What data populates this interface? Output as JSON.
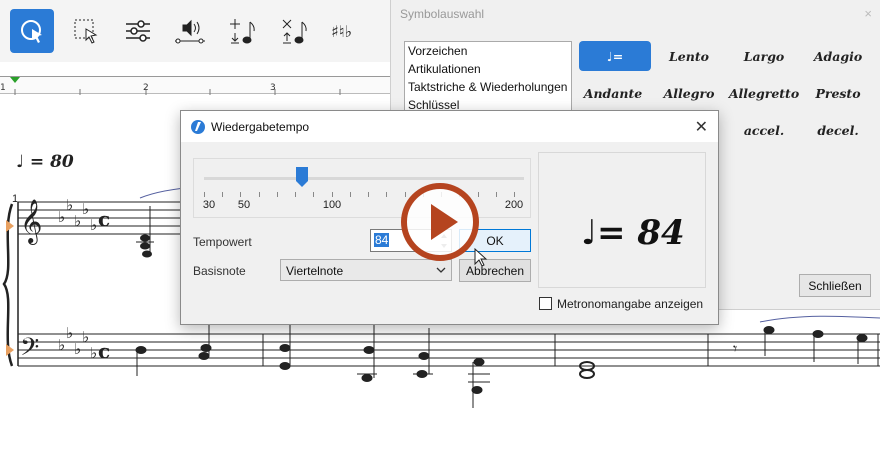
{
  "toolbar": {
    "tools": [
      {
        "icon": "pointer-select-icon",
        "active": true
      },
      {
        "icon": "marquee-select-icon"
      },
      {
        "icon": "mixer-sliders-icon"
      },
      {
        "icon": "playback-speaker-icon"
      },
      {
        "icon": "add-note-icon"
      },
      {
        "icon": "delete-note-icon"
      },
      {
        "icon": "accidentals-icon"
      }
    ]
  },
  "ruler": {
    "labels": [
      "1",
      "2",
      "3"
    ]
  },
  "score": {
    "tempo_mark": "♩ = 80",
    "measure_number": "1"
  },
  "palette": {
    "title": "Symbolauswahl",
    "close": "×",
    "categories": [
      "Vorzeichen",
      "Artikulationen",
      "Taktstriche & Wiederholungen",
      "Schlüssel"
    ],
    "cells": [
      {
        "label": "♩=",
        "selected": true
      },
      {
        "label": "Lento"
      },
      {
        "label": "Largo"
      },
      {
        "label": "Adagio"
      },
      {
        "label": "Andante"
      },
      {
        "label": "Allegro"
      },
      {
        "label": "Allegretto"
      },
      {
        "label": "Presto"
      },
      {
        "label": "accel."
      },
      {
        "label": "decel."
      }
    ],
    "close_button": "Schließen"
  },
  "dialog": {
    "title": "Wiedergabetempo",
    "close": "✕",
    "slider": {
      "min": 30,
      "max": 200,
      "value": 84,
      "tick_labels": [
        "30",
        "50",
        "100",
        "200"
      ]
    },
    "tempo_label": "Tempowert",
    "tempo_value": "84",
    "ok_button": "OK",
    "base_note_label": "Basisnote",
    "base_note_value": "Viertelnote",
    "cancel_button": "Abbrechen",
    "preview": "♩= 84",
    "metronome_checkbox": "Metronomangabe anzeigen",
    "metronome_checked": false
  },
  "video": {
    "play_color": "#b5441f"
  },
  "colors": {
    "accent": "#2b7bd6"
  }
}
